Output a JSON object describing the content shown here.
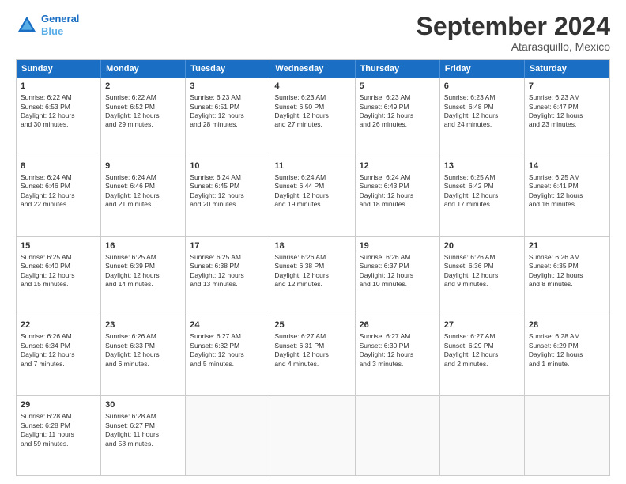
{
  "header": {
    "logo_line1": "General",
    "logo_line2": "Blue",
    "month": "September 2024",
    "location": "Atarasquillo, Mexico"
  },
  "weekdays": [
    "Sunday",
    "Monday",
    "Tuesday",
    "Wednesday",
    "Thursday",
    "Friday",
    "Saturday"
  ],
  "rows": [
    [
      {
        "day": "1",
        "lines": [
          "Sunrise: 6:22 AM",
          "Sunset: 6:53 PM",
          "Daylight: 12 hours",
          "and 30 minutes."
        ]
      },
      {
        "day": "2",
        "lines": [
          "Sunrise: 6:22 AM",
          "Sunset: 6:52 PM",
          "Daylight: 12 hours",
          "and 29 minutes."
        ]
      },
      {
        "day": "3",
        "lines": [
          "Sunrise: 6:23 AM",
          "Sunset: 6:51 PM",
          "Daylight: 12 hours",
          "and 28 minutes."
        ]
      },
      {
        "day": "4",
        "lines": [
          "Sunrise: 6:23 AM",
          "Sunset: 6:50 PM",
          "Daylight: 12 hours",
          "and 27 minutes."
        ]
      },
      {
        "day": "5",
        "lines": [
          "Sunrise: 6:23 AM",
          "Sunset: 6:49 PM",
          "Daylight: 12 hours",
          "and 26 minutes."
        ]
      },
      {
        "day": "6",
        "lines": [
          "Sunrise: 6:23 AM",
          "Sunset: 6:48 PM",
          "Daylight: 12 hours",
          "and 24 minutes."
        ]
      },
      {
        "day": "7",
        "lines": [
          "Sunrise: 6:23 AM",
          "Sunset: 6:47 PM",
          "Daylight: 12 hours",
          "and 23 minutes."
        ]
      }
    ],
    [
      {
        "day": "8",
        "lines": [
          "Sunrise: 6:24 AM",
          "Sunset: 6:46 PM",
          "Daylight: 12 hours",
          "and 22 minutes."
        ]
      },
      {
        "day": "9",
        "lines": [
          "Sunrise: 6:24 AM",
          "Sunset: 6:46 PM",
          "Daylight: 12 hours",
          "and 21 minutes."
        ]
      },
      {
        "day": "10",
        "lines": [
          "Sunrise: 6:24 AM",
          "Sunset: 6:45 PM",
          "Daylight: 12 hours",
          "and 20 minutes."
        ]
      },
      {
        "day": "11",
        "lines": [
          "Sunrise: 6:24 AM",
          "Sunset: 6:44 PM",
          "Daylight: 12 hours",
          "and 19 minutes."
        ]
      },
      {
        "day": "12",
        "lines": [
          "Sunrise: 6:24 AM",
          "Sunset: 6:43 PM",
          "Daylight: 12 hours",
          "and 18 minutes."
        ]
      },
      {
        "day": "13",
        "lines": [
          "Sunrise: 6:25 AM",
          "Sunset: 6:42 PM",
          "Daylight: 12 hours",
          "and 17 minutes."
        ]
      },
      {
        "day": "14",
        "lines": [
          "Sunrise: 6:25 AM",
          "Sunset: 6:41 PM",
          "Daylight: 12 hours",
          "and 16 minutes."
        ]
      }
    ],
    [
      {
        "day": "15",
        "lines": [
          "Sunrise: 6:25 AM",
          "Sunset: 6:40 PM",
          "Daylight: 12 hours",
          "and 15 minutes."
        ]
      },
      {
        "day": "16",
        "lines": [
          "Sunrise: 6:25 AM",
          "Sunset: 6:39 PM",
          "Daylight: 12 hours",
          "and 14 minutes."
        ]
      },
      {
        "day": "17",
        "lines": [
          "Sunrise: 6:25 AM",
          "Sunset: 6:38 PM",
          "Daylight: 12 hours",
          "and 13 minutes."
        ]
      },
      {
        "day": "18",
        "lines": [
          "Sunrise: 6:26 AM",
          "Sunset: 6:38 PM",
          "Daylight: 12 hours",
          "and 12 minutes."
        ]
      },
      {
        "day": "19",
        "lines": [
          "Sunrise: 6:26 AM",
          "Sunset: 6:37 PM",
          "Daylight: 12 hours",
          "and 10 minutes."
        ]
      },
      {
        "day": "20",
        "lines": [
          "Sunrise: 6:26 AM",
          "Sunset: 6:36 PM",
          "Daylight: 12 hours",
          "and 9 minutes."
        ]
      },
      {
        "day": "21",
        "lines": [
          "Sunrise: 6:26 AM",
          "Sunset: 6:35 PM",
          "Daylight: 12 hours",
          "and 8 minutes."
        ]
      }
    ],
    [
      {
        "day": "22",
        "lines": [
          "Sunrise: 6:26 AM",
          "Sunset: 6:34 PM",
          "Daylight: 12 hours",
          "and 7 minutes."
        ]
      },
      {
        "day": "23",
        "lines": [
          "Sunrise: 6:26 AM",
          "Sunset: 6:33 PM",
          "Daylight: 12 hours",
          "and 6 minutes."
        ]
      },
      {
        "day": "24",
        "lines": [
          "Sunrise: 6:27 AM",
          "Sunset: 6:32 PM",
          "Daylight: 12 hours",
          "and 5 minutes."
        ]
      },
      {
        "day": "25",
        "lines": [
          "Sunrise: 6:27 AM",
          "Sunset: 6:31 PM",
          "Daylight: 12 hours",
          "and 4 minutes."
        ]
      },
      {
        "day": "26",
        "lines": [
          "Sunrise: 6:27 AM",
          "Sunset: 6:30 PM",
          "Daylight: 12 hours",
          "and 3 minutes."
        ]
      },
      {
        "day": "27",
        "lines": [
          "Sunrise: 6:27 AM",
          "Sunset: 6:29 PM",
          "Daylight: 12 hours",
          "and 2 minutes."
        ]
      },
      {
        "day": "28",
        "lines": [
          "Sunrise: 6:28 AM",
          "Sunset: 6:29 PM",
          "Daylight: 12 hours",
          "and 1 minute."
        ]
      }
    ],
    [
      {
        "day": "29",
        "lines": [
          "Sunrise: 6:28 AM",
          "Sunset: 6:28 PM",
          "Daylight: 11 hours",
          "and 59 minutes."
        ]
      },
      {
        "day": "30",
        "lines": [
          "Sunrise: 6:28 AM",
          "Sunset: 6:27 PM",
          "Daylight: 11 hours",
          "and 58 minutes."
        ]
      },
      {
        "day": "",
        "lines": []
      },
      {
        "day": "",
        "lines": []
      },
      {
        "day": "",
        "lines": []
      },
      {
        "day": "",
        "lines": []
      },
      {
        "day": "",
        "lines": []
      }
    ]
  ]
}
